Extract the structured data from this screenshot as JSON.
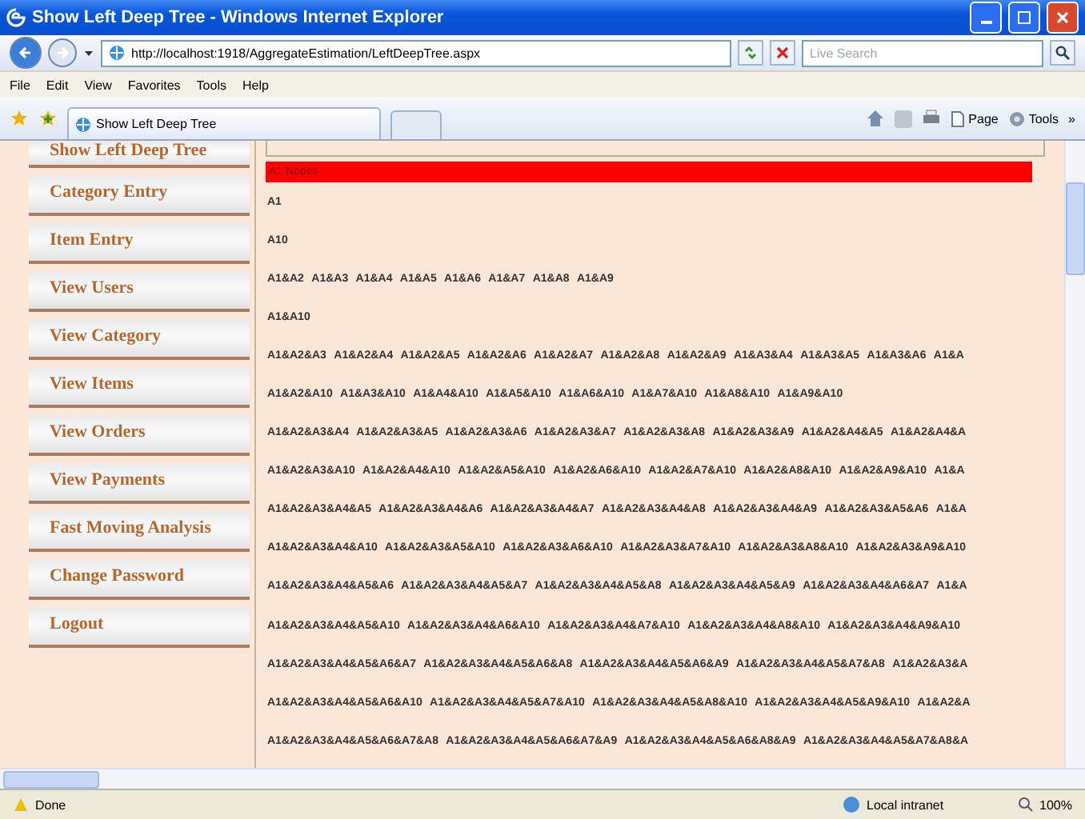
{
  "window": {
    "title": "Show Left Deep Tree - Windows Internet Explorer"
  },
  "address_bar": {
    "url": "http://localhost:1918/AggregateEstimation/LeftDeepTree.aspx",
    "search_placeholder": "Live Search"
  },
  "menu": [
    "File",
    "Edit",
    "View",
    "Favorites",
    "Tools",
    "Help"
  ],
  "toolbar": {
    "tab": "Show Left Deep Tree",
    "page_button": "Page",
    "tools_button": "Tools",
    "overflow": "»"
  },
  "sidebar": {
    "items": [
      "Show Left Deep Tree",
      "Category Entry",
      "Item Entry",
      "View Users",
      "View Category",
      "View Items",
      "View Orders",
      "View Payments",
      "Fast Moving Analysis",
      "Change Password",
      "Logout"
    ]
  },
  "content": {
    "heading": "A1 Nodes",
    "rows": [
      "A1",
      "A10",
      "A1&A2 A1&A3 A1&A4 A1&A5 A1&A6 A1&A7 A1&A8 A1&A9",
      "A1&A10",
      "A1&A2&A3 A1&A2&A4 A1&A2&A5 A1&A2&A6 A1&A2&A7 A1&A2&A8 A1&A2&A9 A1&A3&A4 A1&A3&A5 A1&A3&A6 A1&A",
      "A1&A2&A10 A1&A3&A10 A1&A4&A10 A1&A5&A10 A1&A6&A10 A1&A7&A10 A1&A8&A10 A1&A9&A10",
      "A1&A2&A3&A4 A1&A2&A3&A5 A1&A2&A3&A6 A1&A2&A3&A7 A1&A2&A3&A8 A1&A2&A3&A9 A1&A2&A4&A5 A1&A2&A4&A",
      "A1&A2&A3&A10 A1&A2&A4&A10 A1&A2&A5&A10 A1&A2&A6&A10 A1&A2&A7&A10 A1&A2&A8&A10 A1&A2&A9&A10 A1&A",
      "A1&A2&A3&A4&A5 A1&A2&A3&A4&A6 A1&A2&A3&A4&A7 A1&A2&A3&A4&A8 A1&A2&A3&A4&A9 A1&A2&A3&A5&A6 A1&A",
      "A1&A2&A3&A4&A10 A1&A2&A3&A5&A10 A1&A2&A3&A6&A10 A1&A2&A3&A7&A10 A1&A2&A3&A8&A10 A1&A2&A3&A9&A10",
      "A1&A2&A3&A4&A5&A6 A1&A2&A3&A4&A5&A7 A1&A2&A3&A4&A5&A8 A1&A2&A3&A4&A5&A9 A1&A2&A3&A4&A6&A7 A1&A",
      "A1&A2&A3&A4&A5&A10 A1&A2&A3&A4&A6&A10 A1&A2&A3&A4&A7&A10 A1&A2&A3&A4&A8&A10 A1&A2&A3&A4&A9&A10",
      "A1&A2&A3&A4&A5&A6&A7 A1&A2&A3&A4&A5&A6&A8 A1&A2&A3&A4&A5&A6&A9 A1&A2&A3&A4&A5&A7&A8 A1&A2&A3&A",
      "A1&A2&A3&A4&A5&A6&A10 A1&A2&A3&A4&A5&A7&A10 A1&A2&A3&A4&A5&A8&A10 A1&A2&A3&A4&A5&A9&A10 A1&A2&A",
      "A1&A2&A3&A4&A5&A6&A7&A8 A1&A2&A3&A4&A5&A6&A7&A9 A1&A2&A3&A4&A5&A6&A8&A9 A1&A2&A3&A4&A5&A7&A8&A"
    ]
  },
  "status_bar": {
    "status": "Done",
    "zone": "Local intranet",
    "zoom": "100%"
  }
}
